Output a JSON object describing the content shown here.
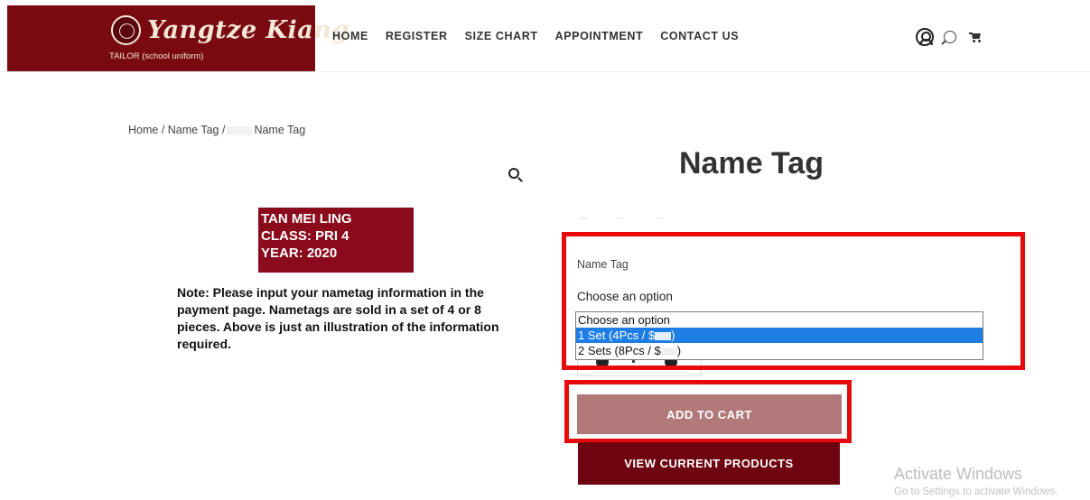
{
  "header": {
    "logo_script": "Yangtze Kiang",
    "logo_subtitle": "TAILOR (school uniform)",
    "brand_color": "#7a0a12",
    "nav": [
      {
        "label": "HOME"
      },
      {
        "label": "REGISTER"
      },
      {
        "label": "SIZE CHART"
      },
      {
        "label": "APPOINTMENT"
      },
      {
        "label": "CONTACT US"
      }
    ],
    "icons": [
      "user-account-icon",
      "search-icon",
      "cart-icon"
    ]
  },
  "breadcrumb": {
    "part1": "Home / Name Tag /",
    "part2": "Name Tag"
  },
  "product_image": {
    "tag_lines": [
      "TAN MEI LING",
      "CLASS: PRI 4",
      "YEAR: 2020"
    ],
    "tag_color": "#8b0a1c",
    "note": "Note:  Please input your nametag information in the payment page.  Nametags are sold in a set of 4 or 8 pieces. Above is just an illustration of the information required."
  },
  "product": {
    "title": "Name Tag",
    "attribute_label": "Name Tag",
    "select_value": "Choose an option",
    "options": [
      {
        "label_a": "Choose an option",
        "label_b": ""
      },
      {
        "label_a": "1 Set (4Pcs / $",
        "label_b": ")"
      },
      {
        "label_a": "2 Sets (8Pcs / $",
        "label_b": ")"
      }
    ],
    "selected_option_index": 1,
    "add_to_cart": "ADD TO CART",
    "view_products": "VIEW CURRENT PRODUCTS",
    "highlight_color": "#e8090d",
    "add_button_color": "#b17979",
    "view_button_color": "#6e0410",
    "selection_color": "#1e7ee6"
  },
  "watermark": {
    "title": "Activate Windows",
    "subtitle": "Go to Settings to activate Windows."
  }
}
